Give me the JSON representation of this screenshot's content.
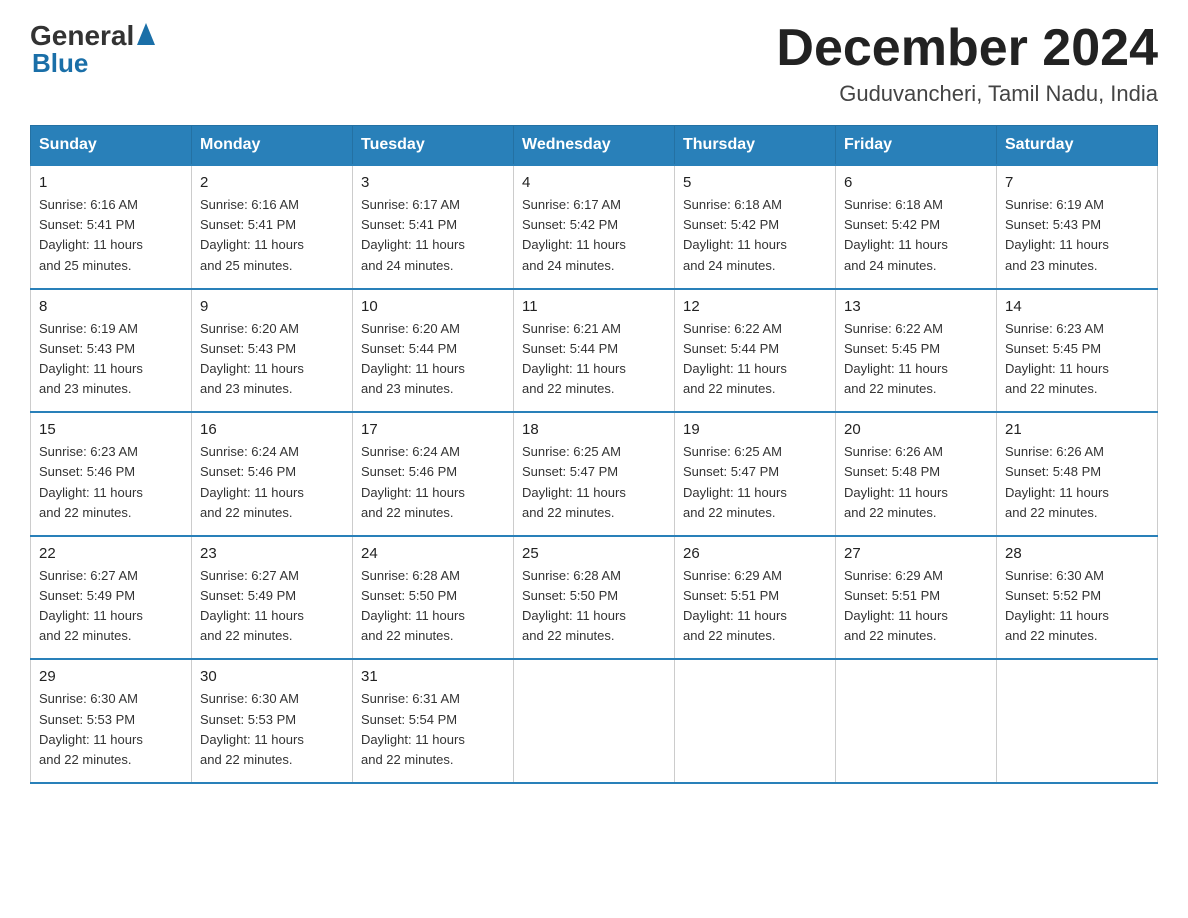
{
  "header": {
    "logo_general": "General",
    "logo_blue": "Blue",
    "month_title": "December 2024",
    "location": "Guduvancheri, Tamil Nadu, India"
  },
  "days_of_week": [
    "Sunday",
    "Monday",
    "Tuesday",
    "Wednesday",
    "Thursday",
    "Friday",
    "Saturday"
  ],
  "weeks": [
    [
      {
        "day": "1",
        "sunrise": "6:16 AM",
        "sunset": "5:41 PM",
        "daylight": "11 hours and 25 minutes."
      },
      {
        "day": "2",
        "sunrise": "6:16 AM",
        "sunset": "5:41 PM",
        "daylight": "11 hours and 25 minutes."
      },
      {
        "day": "3",
        "sunrise": "6:17 AM",
        "sunset": "5:41 PM",
        "daylight": "11 hours and 24 minutes."
      },
      {
        "day": "4",
        "sunrise": "6:17 AM",
        "sunset": "5:42 PM",
        "daylight": "11 hours and 24 minutes."
      },
      {
        "day": "5",
        "sunrise": "6:18 AM",
        "sunset": "5:42 PM",
        "daylight": "11 hours and 24 minutes."
      },
      {
        "day": "6",
        "sunrise": "6:18 AM",
        "sunset": "5:42 PM",
        "daylight": "11 hours and 24 minutes."
      },
      {
        "day": "7",
        "sunrise": "6:19 AM",
        "sunset": "5:43 PM",
        "daylight": "11 hours and 23 minutes."
      }
    ],
    [
      {
        "day": "8",
        "sunrise": "6:19 AM",
        "sunset": "5:43 PM",
        "daylight": "11 hours and 23 minutes."
      },
      {
        "day": "9",
        "sunrise": "6:20 AM",
        "sunset": "5:43 PM",
        "daylight": "11 hours and 23 minutes."
      },
      {
        "day": "10",
        "sunrise": "6:20 AM",
        "sunset": "5:44 PM",
        "daylight": "11 hours and 23 minutes."
      },
      {
        "day": "11",
        "sunrise": "6:21 AM",
        "sunset": "5:44 PM",
        "daylight": "11 hours and 22 minutes."
      },
      {
        "day": "12",
        "sunrise": "6:22 AM",
        "sunset": "5:44 PM",
        "daylight": "11 hours and 22 minutes."
      },
      {
        "day": "13",
        "sunrise": "6:22 AM",
        "sunset": "5:45 PM",
        "daylight": "11 hours and 22 minutes."
      },
      {
        "day": "14",
        "sunrise": "6:23 AM",
        "sunset": "5:45 PM",
        "daylight": "11 hours and 22 minutes."
      }
    ],
    [
      {
        "day": "15",
        "sunrise": "6:23 AM",
        "sunset": "5:46 PM",
        "daylight": "11 hours and 22 minutes."
      },
      {
        "day": "16",
        "sunrise": "6:24 AM",
        "sunset": "5:46 PM",
        "daylight": "11 hours and 22 minutes."
      },
      {
        "day": "17",
        "sunrise": "6:24 AM",
        "sunset": "5:46 PM",
        "daylight": "11 hours and 22 minutes."
      },
      {
        "day": "18",
        "sunrise": "6:25 AM",
        "sunset": "5:47 PM",
        "daylight": "11 hours and 22 minutes."
      },
      {
        "day": "19",
        "sunrise": "6:25 AM",
        "sunset": "5:47 PM",
        "daylight": "11 hours and 22 minutes."
      },
      {
        "day": "20",
        "sunrise": "6:26 AM",
        "sunset": "5:48 PM",
        "daylight": "11 hours and 22 minutes."
      },
      {
        "day": "21",
        "sunrise": "6:26 AM",
        "sunset": "5:48 PM",
        "daylight": "11 hours and 22 minutes."
      }
    ],
    [
      {
        "day": "22",
        "sunrise": "6:27 AM",
        "sunset": "5:49 PM",
        "daylight": "11 hours and 22 minutes."
      },
      {
        "day": "23",
        "sunrise": "6:27 AM",
        "sunset": "5:49 PM",
        "daylight": "11 hours and 22 minutes."
      },
      {
        "day": "24",
        "sunrise": "6:28 AM",
        "sunset": "5:50 PM",
        "daylight": "11 hours and 22 minutes."
      },
      {
        "day": "25",
        "sunrise": "6:28 AM",
        "sunset": "5:50 PM",
        "daylight": "11 hours and 22 minutes."
      },
      {
        "day": "26",
        "sunrise": "6:29 AM",
        "sunset": "5:51 PM",
        "daylight": "11 hours and 22 minutes."
      },
      {
        "day": "27",
        "sunrise": "6:29 AM",
        "sunset": "5:51 PM",
        "daylight": "11 hours and 22 minutes."
      },
      {
        "day": "28",
        "sunrise": "6:30 AM",
        "sunset": "5:52 PM",
        "daylight": "11 hours and 22 minutes."
      }
    ],
    [
      {
        "day": "29",
        "sunrise": "6:30 AM",
        "sunset": "5:53 PM",
        "daylight": "11 hours and 22 minutes."
      },
      {
        "day": "30",
        "sunrise": "6:30 AM",
        "sunset": "5:53 PM",
        "daylight": "11 hours and 22 minutes."
      },
      {
        "day": "31",
        "sunrise": "6:31 AM",
        "sunset": "5:54 PM",
        "daylight": "11 hours and 22 minutes."
      },
      null,
      null,
      null,
      null
    ]
  ],
  "labels": {
    "sunrise": "Sunrise:",
    "sunset": "Sunset:",
    "daylight": "Daylight:"
  }
}
